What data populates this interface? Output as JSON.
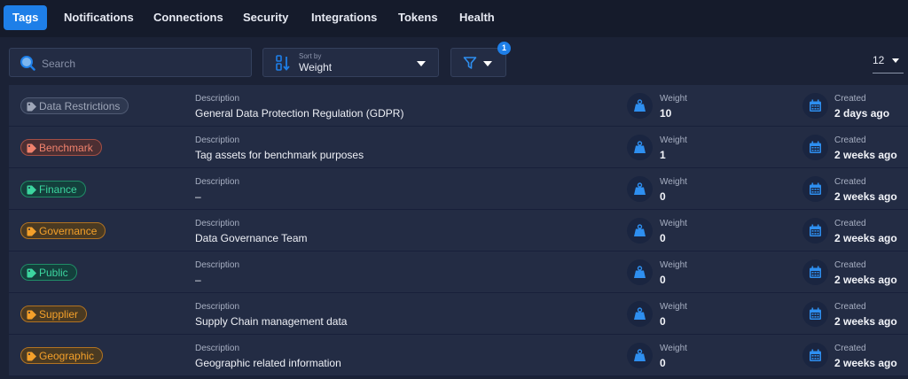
{
  "tabs": [
    {
      "label": "Tags",
      "active": true
    },
    {
      "label": "Notifications",
      "active": false
    },
    {
      "label": "Connections",
      "active": false
    },
    {
      "label": "Security",
      "active": false
    },
    {
      "label": "Integrations",
      "active": false
    },
    {
      "label": "Tokens",
      "active": false
    },
    {
      "label": "Health",
      "active": false
    }
  ],
  "filters": {
    "search_placeholder": "Search",
    "sort_by_label": "Sort by",
    "sort_by_value": "Weight",
    "filter_count": "1",
    "page_size": "12"
  },
  "icons": {
    "search": "magnifier-icon",
    "sort": "sort-icon",
    "filter": "funnel-icon",
    "tag": "tag-icon",
    "weight": "weight-icon",
    "created": "calendar-icon"
  },
  "colors": {
    "accent": "#1e7fe8",
    "background": "#1b2236",
    "row": "#232c44"
  },
  "columns": {
    "description": "Description",
    "weight": "Weight",
    "created": "Created"
  },
  "tags": [
    {
      "name": "Data Restrictions",
      "color": "#9ea6b8",
      "bg": "#2e3850",
      "border": "#4f5a73",
      "description": "General Data Protection Regulation (GDPR)",
      "weight": "10",
      "created": "2 days ago"
    },
    {
      "name": "Benchmark",
      "color": "#f0826d",
      "bg": "#4c2f33",
      "border": "#a44f45",
      "description": "Tag assets for benchmark purposes",
      "weight": "1",
      "created": "2 weeks ago"
    },
    {
      "name": "Finance",
      "color": "#3cd59f",
      "bg": "#143f3c",
      "border": "#1f8d67",
      "description": "–",
      "weight": "0",
      "created": "2 weeks ago"
    },
    {
      "name": "Governance",
      "color": "#f4a02a",
      "bg": "#4a3a22",
      "border": "#b17322",
      "description": "Data Governance Team",
      "weight": "0",
      "created": "2 weeks ago"
    },
    {
      "name": "Public",
      "color": "#3cd59f",
      "bg": "#143f3c",
      "border": "#1f8d67",
      "description": "–",
      "weight": "0",
      "created": "2 weeks ago"
    },
    {
      "name": "Supplier",
      "color": "#f4a02a",
      "bg": "#4a3a22",
      "border": "#b17322",
      "description": "Supply Chain management data",
      "weight": "0",
      "created": "2 weeks ago"
    },
    {
      "name": "Geographic",
      "color": "#f4a02a",
      "bg": "#4a3a22",
      "border": "#b17322",
      "description": "Geographic related information",
      "weight": "0",
      "created": "2 weeks ago"
    }
  ]
}
